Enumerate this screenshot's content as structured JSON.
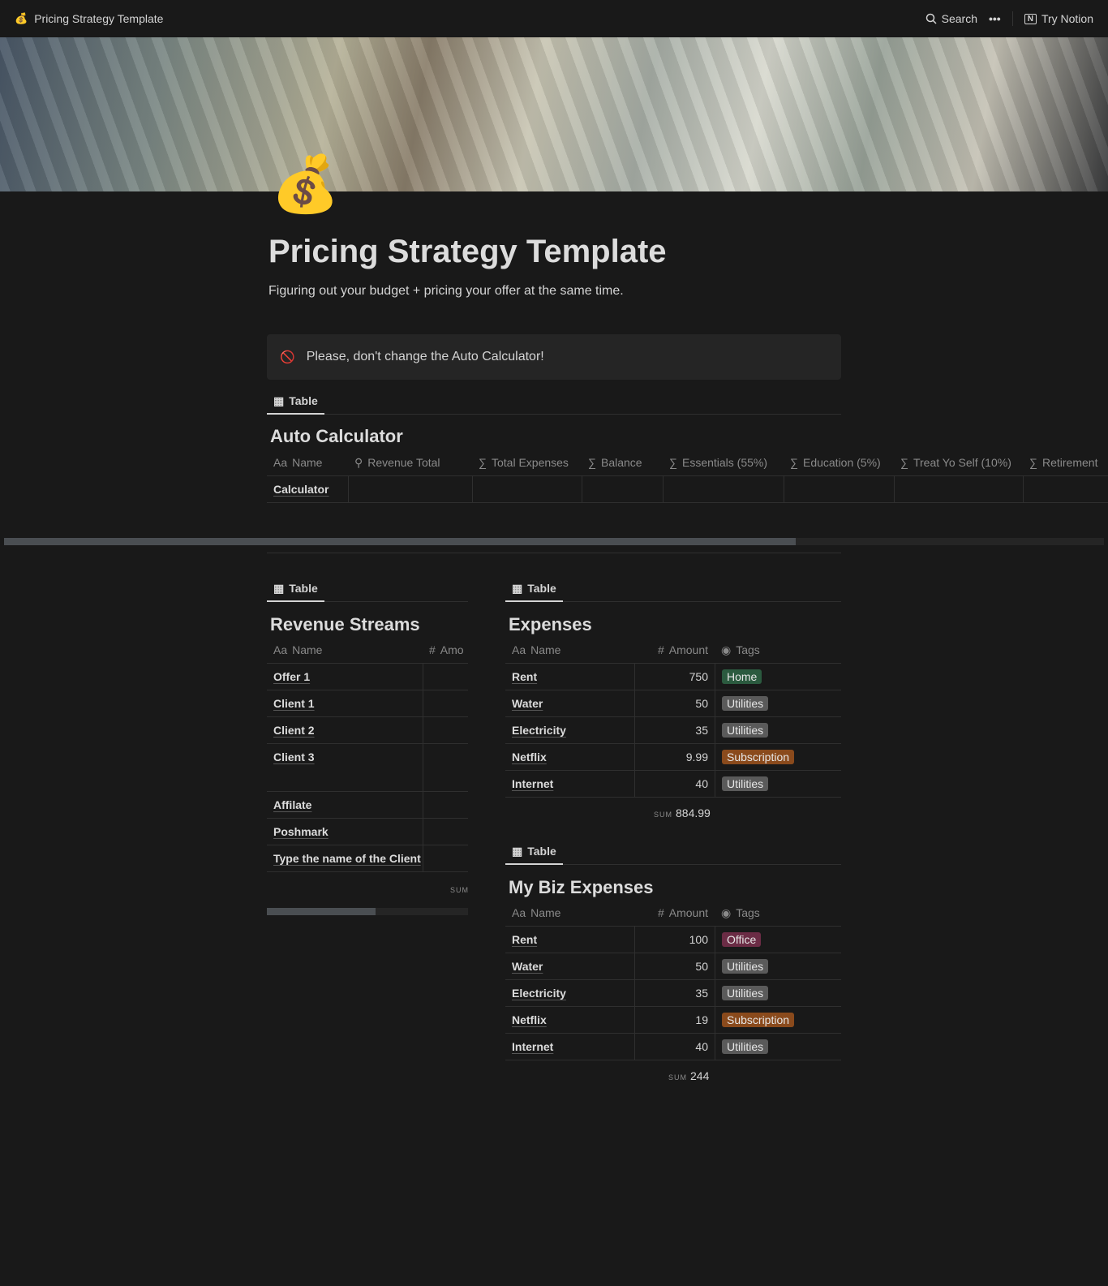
{
  "topbar": {
    "title": "Pricing Strategy Template",
    "search": "Search",
    "more": "•••",
    "try": "Try Notion"
  },
  "page": {
    "icon": "💰",
    "title": "Pricing Strategy Template",
    "subtitle": "Figuring out your budget + pricing your offer at the same time.",
    "callout": "Please, don't change the Auto Calculator!",
    "callout_icon": "🚫"
  },
  "view_label": "Table",
  "auto": {
    "title": "Auto Calculator",
    "columns": [
      "Name",
      "Revenue Total",
      "Total Expenses",
      "Balance",
      "Essentials (55%)",
      "Education (5%)",
      "Treat Yo Self (10%)",
      "Retirement"
    ],
    "rows": [
      "Calculator"
    ]
  },
  "revenue": {
    "title": "Revenue Streams",
    "columns": [
      "Name",
      "Amo"
    ],
    "rows": [
      "Offer 1",
      "Client 1",
      "Client 2",
      "Client 3",
      "Affilate",
      "Poshmark",
      "Type the name of the Client"
    ],
    "sum_label": "SUM"
  },
  "expenses": {
    "title": "Expenses",
    "columns": [
      "Name",
      "Amount",
      "Tags"
    ],
    "rows": [
      {
        "name": "Rent",
        "amount": "750",
        "tag": "Home",
        "color": "#2b5a3f"
      },
      {
        "name": "Water",
        "amount": "50",
        "tag": "Utilities",
        "color": "#5a5a5a"
      },
      {
        "name": "Electricity",
        "amount": "35",
        "tag": "Utilities",
        "color": "#5a5a5a"
      },
      {
        "name": "Netflix",
        "amount": "9.99",
        "tag": "Subscription",
        "color": "#8a4a1c"
      },
      {
        "name": "Internet",
        "amount": "40",
        "tag": "Utilities",
        "color": "#5a5a5a"
      }
    ],
    "sum_label": "SUM",
    "sum": "884.99"
  },
  "biz": {
    "title": "My Biz Expenses",
    "columns": [
      "Name",
      "Amount",
      "Tags"
    ],
    "rows": [
      {
        "name": "Rent",
        "amount": "100",
        "tag": "Office",
        "color": "#6b2c45"
      },
      {
        "name": "Water",
        "amount": "50",
        "tag": "Utilities",
        "color": "#5a5a5a"
      },
      {
        "name": "Electricity",
        "amount": "35",
        "tag": "Utilities",
        "color": "#5a5a5a"
      },
      {
        "name": "Netflix",
        "amount": "19",
        "tag": "Subscription",
        "color": "#8a4a1c"
      },
      {
        "name": "Internet",
        "amount": "40",
        "tag": "Utilities",
        "color": "#5a5a5a"
      }
    ],
    "sum_label": "SUM",
    "sum": "244"
  }
}
